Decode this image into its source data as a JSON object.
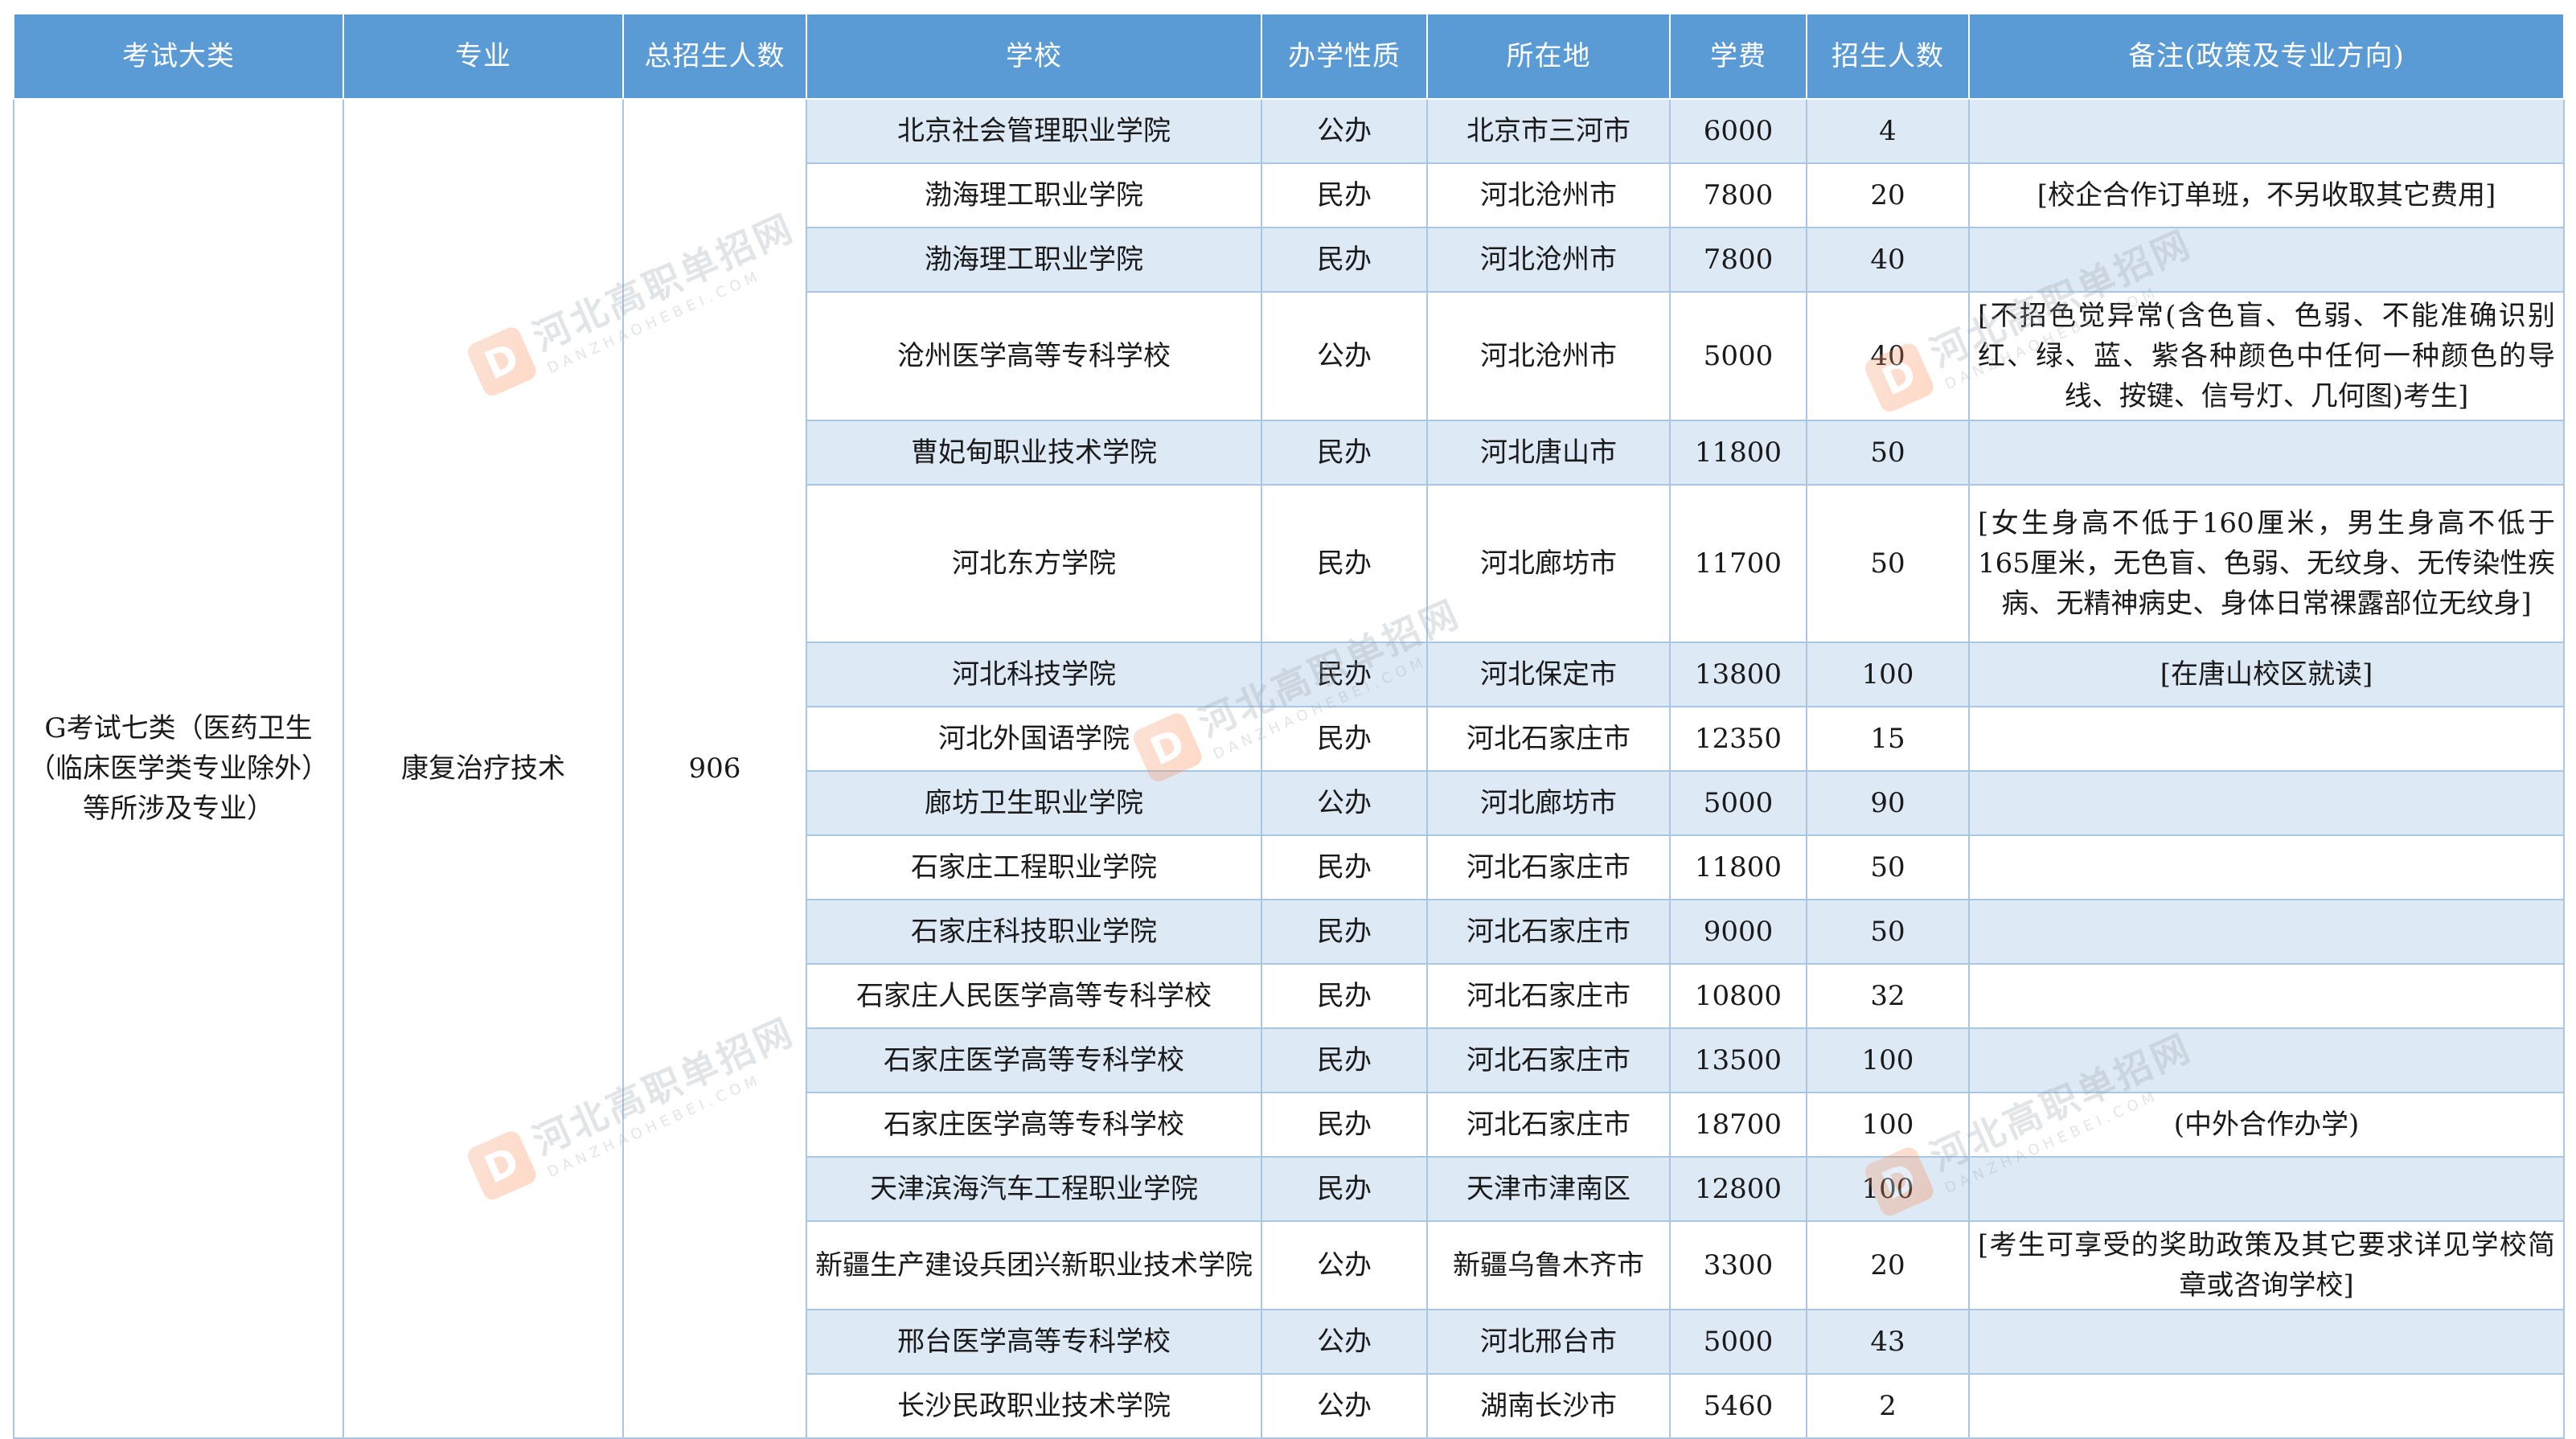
{
  "table": {
    "headers": [
      "考试大类",
      "专业",
      "总招生人数",
      "学校",
      "办学性质",
      "所在地",
      "学费",
      "招生人数",
      "备注(政策及专业方向)"
    ],
    "category": "G考试七类（医药卫生（临床医学类专业除外）等所涉及专业）",
    "major": "康复治疗技术",
    "total": "906",
    "rows": [
      {
        "school": "北京社会管理职业学院",
        "nature": "公办",
        "location": "北京市三河市",
        "fee": "6000",
        "count": "4",
        "remark": ""
      },
      {
        "school": "渤海理工职业学院",
        "nature": "民办",
        "location": "河北沧州市",
        "fee": "7800",
        "count": "20",
        "remark": "[校企合作订单班，不另收取其它费用]"
      },
      {
        "school": "渤海理工职业学院",
        "nature": "民办",
        "location": "河北沧州市",
        "fee": "7800",
        "count": "40",
        "remark": ""
      },
      {
        "school": "沧州医学高等专科学校",
        "nature": "公办",
        "location": "河北沧州市",
        "fee": "5000",
        "count": "40",
        "remark": "[不招色觉异常(含色盲、色弱、不能准确识别红、绿、蓝、紫各种颜色中任何一种颜色的导线、按键、信号灯、几何图)考生]"
      },
      {
        "school": "曹妃甸职业技术学院",
        "nature": "民办",
        "location": "河北唐山市",
        "fee": "11800",
        "count": "50",
        "remark": ""
      },
      {
        "school": "河北东方学院",
        "nature": "民办",
        "location": "河北廊坊市",
        "fee": "11700",
        "count": "50",
        "remark": "[女生身高不低于160厘米，男生身高不低于165厘米，无色盲、色弱、无纹身、无传染性疾病、无精神病史、身体日常裸露部位无纹身]"
      },
      {
        "school": "河北科技学院",
        "nature": "民办",
        "location": "河北保定市",
        "fee": "13800",
        "count": "100",
        "remark": "[在唐山校区就读]"
      },
      {
        "school": "河北外国语学院",
        "nature": "民办",
        "location": "河北石家庄市",
        "fee": "12350",
        "count": "15",
        "remark": ""
      },
      {
        "school": "廊坊卫生职业学院",
        "nature": "公办",
        "location": "河北廊坊市",
        "fee": "5000",
        "count": "90",
        "remark": ""
      },
      {
        "school": "石家庄工程职业学院",
        "nature": "民办",
        "location": "河北石家庄市",
        "fee": "11800",
        "count": "50",
        "remark": ""
      },
      {
        "school": "石家庄科技职业学院",
        "nature": "民办",
        "location": "河北石家庄市",
        "fee": "9000",
        "count": "50",
        "remark": ""
      },
      {
        "school": "石家庄人民医学高等专科学校",
        "nature": "民办",
        "location": "河北石家庄市",
        "fee": "10800",
        "count": "32",
        "remark": ""
      },
      {
        "school": "石家庄医学高等专科学校",
        "nature": "民办",
        "location": "河北石家庄市",
        "fee": "13500",
        "count": "100",
        "remark": ""
      },
      {
        "school": "石家庄医学高等专科学校",
        "nature": "民办",
        "location": "河北石家庄市",
        "fee": "18700",
        "count": "100",
        "remark": "(中外合作办学)"
      },
      {
        "school": "天津滨海汽车工程职业学院",
        "nature": "民办",
        "location": "天津市津南区",
        "fee": "12800",
        "count": "100",
        "remark": ""
      },
      {
        "school": "新疆生产建设兵团兴新职业技术学院",
        "nature": "公办",
        "location": "新疆乌鲁木齐市",
        "fee": "3300",
        "count": "20",
        "remark": "[考生可享受的奖助政策及其它要求详见学校简章或咨询学校]"
      },
      {
        "school": "邢台医学高等专科学校",
        "nature": "公办",
        "location": "河北邢台市",
        "fee": "5000",
        "count": "43",
        "remark": ""
      },
      {
        "school": "长沙民政职业技术学院",
        "nature": "公办",
        "location": "湖南长沙市",
        "fee": "5460",
        "count": "2",
        "remark": ""
      }
    ]
  },
  "watermark": {
    "main": "河北高职单招网",
    "sub": "DANZHAOHEBEI.COM",
    "logo": "D"
  },
  "colors": {
    "header_bg": "#5b9bd5",
    "stripe": "#dde9f5",
    "border": "#a9c6e2"
  }
}
